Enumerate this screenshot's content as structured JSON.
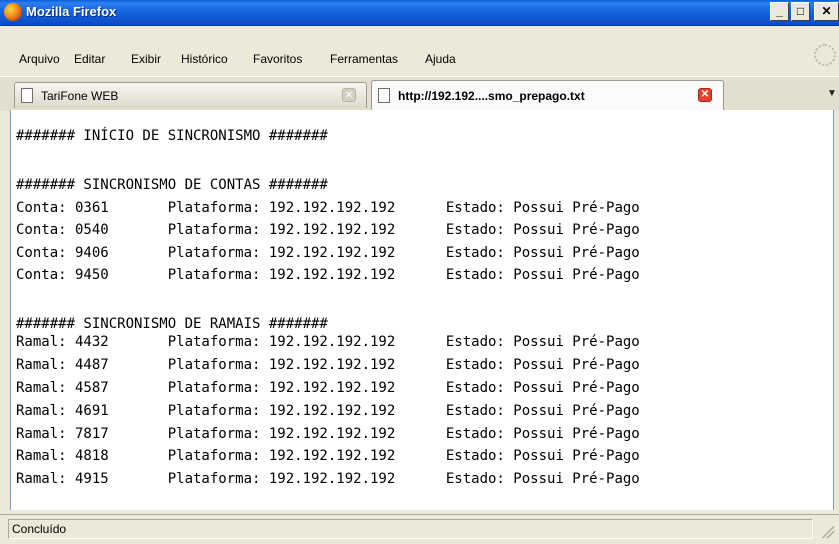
{
  "window": {
    "title": "Mozilla Firefox"
  },
  "menu": [
    "Arquivo",
    "Editar",
    "Exibir",
    "Histórico",
    "Favoritos",
    "Ferramentas",
    "Ajuda"
  ],
  "tabs": [
    {
      "label": "TariFone WEB",
      "active": false
    },
    {
      "label": "http://192.192....smo_prepago.txt",
      "active": true
    }
  ],
  "content": {
    "lines": [
      "####### INÍCIO DE SINCRONISMO #######",
      "",
      "####### SINCRONISMO DE CONTAS #######",
      "Conta: 0361       Plataforma: 192.192.192.192      Estado: Possui Pré-Pago",
      "Conta: 0540       Plataforma: 192.192.192.192      Estado: Possui Pré-Pago",
      "Conta: 9406       Plataforma: 192.192.192.192      Estado: Possui Pré-Pago",
      "Conta: 9450       Plataforma: 192.192.192.192      Estado: Possui Pré-Pago",
      "",
      "####### SINCRONISMO DE RAMAIS #######",
      "Ramal: 4432       Plataforma: 192.192.192.192      Estado: Possui Pré-Pago",
      "Ramal: 4487       Plataforma: 192.192.192.192      Estado: Possui Pré-Pago",
      "Ramal: 4587       Plataforma: 192.192.192.192      Estado: Possui Pré-Pago",
      "Ramal: 4691       Plataforma: 192.192.192.192      Estado: Possui Pré-Pago",
      "Ramal: 7817       Plataforma: 192.192.192.192      Estado: Possui Pré-Pago",
      "Ramal: 4818       Plataforma: 192.192.192.192      Estado: Possui Pré-Pago",
      "Ramal: 4915       Plataforma: 192.192.192.192      Estado: Possui Pré-Pago"
    ]
  },
  "status": {
    "text": "Concluído"
  }
}
